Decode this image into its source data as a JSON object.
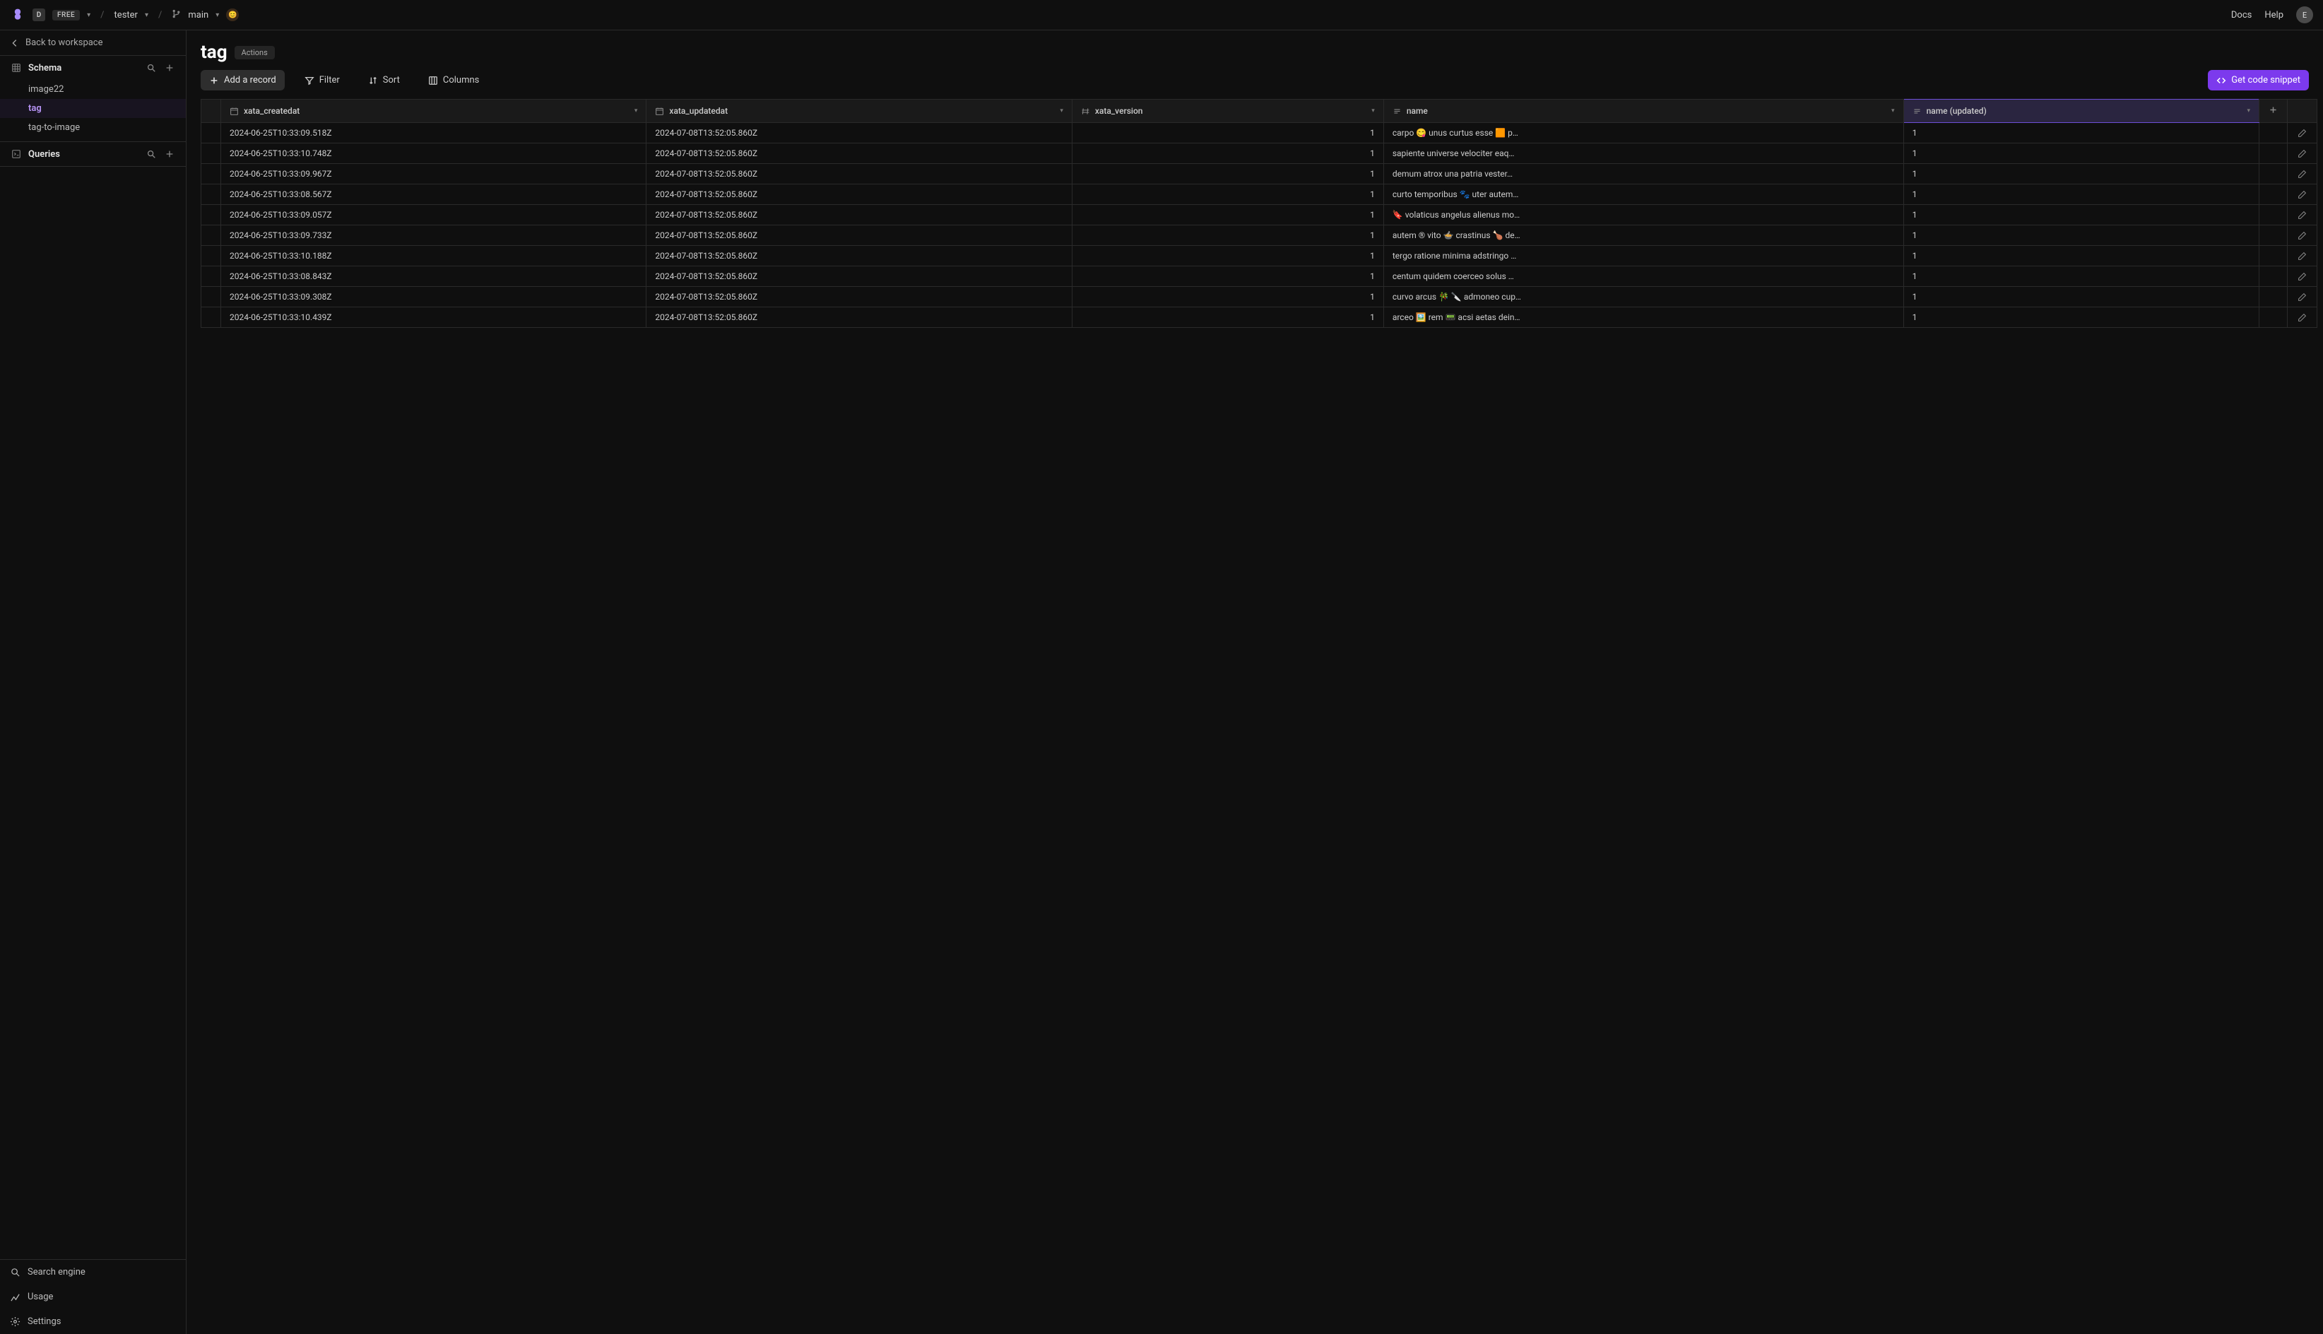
{
  "topbar": {
    "badge_d": "D",
    "badge_free": "FREE",
    "workspace": "tester",
    "branch": "main",
    "docs": "Docs",
    "help": "Help",
    "avatar_initial": "E"
  },
  "sidebar": {
    "back_label": "Back to workspace",
    "schema_label": "Schema",
    "queries_label": "Queries",
    "tables": [
      {
        "label": "image22",
        "active": false
      },
      {
        "label": "tag",
        "active": true
      },
      {
        "label": "tag-to-image",
        "active": false
      }
    ],
    "footer": {
      "search": "Search engine",
      "usage": "Usage",
      "settings": "Settings"
    }
  },
  "header": {
    "title": "tag",
    "actions_label": "Actions"
  },
  "toolbar": {
    "add_record": "Add a record",
    "filter": "Filter",
    "sort": "Sort",
    "columns": "Columns",
    "get_snippet": "Get code snippet"
  },
  "columns": [
    {
      "key": "xata_createdat",
      "label": "xata_createdat",
      "icon": "date"
    },
    {
      "key": "xata_updatedat",
      "label": "xata_updatedat",
      "icon": "date"
    },
    {
      "key": "xata_version",
      "label": "xata_version",
      "icon": "number"
    },
    {
      "key": "name",
      "label": "name",
      "icon": "text"
    },
    {
      "key": "name_updated",
      "label": "name (updated)",
      "icon": "text",
      "highlighted": true
    }
  ],
  "rows": [
    {
      "created": "2024-06-25T10:33:09.518Z",
      "updated": "2024-07-08T13:52:05.860Z",
      "version": "1",
      "name": "carpo 😋 unus curtus esse 🟧 p…",
      "name_updated": "1"
    },
    {
      "created": "2024-06-25T10:33:10.748Z",
      "updated": "2024-07-08T13:52:05.860Z",
      "version": "1",
      "name": "sapiente universe velociter eaq…",
      "name_updated": "1"
    },
    {
      "created": "2024-06-25T10:33:09.967Z",
      "updated": "2024-07-08T13:52:05.860Z",
      "version": "1",
      "name": "demum atrox una patria vester…",
      "name_updated": "1"
    },
    {
      "created": "2024-06-25T10:33:08.567Z",
      "updated": "2024-07-08T13:52:05.860Z",
      "version": "1",
      "name": "curto temporibus 🐾 uter autem…",
      "name_updated": "1"
    },
    {
      "created": "2024-06-25T10:33:09.057Z",
      "updated": "2024-07-08T13:52:05.860Z",
      "version": "1",
      "name": "🔖 volaticus angelus alienus mo…",
      "name_updated": "1"
    },
    {
      "created": "2024-06-25T10:33:09.733Z",
      "updated": "2024-07-08T13:52:05.860Z",
      "version": "1",
      "name": "autem ® vito 🍲 crastinus 🍗 de…",
      "name_updated": "1"
    },
    {
      "created": "2024-06-25T10:33:10.188Z",
      "updated": "2024-07-08T13:52:05.860Z",
      "version": "1",
      "name": "tergo ratione minima adstringo …",
      "name_updated": "1"
    },
    {
      "created": "2024-06-25T10:33:08.843Z",
      "updated": "2024-07-08T13:52:05.860Z",
      "version": "1",
      "name": "centum quidem coerceo solus …",
      "name_updated": "1"
    },
    {
      "created": "2024-06-25T10:33:09.308Z",
      "updated": "2024-07-08T13:52:05.860Z",
      "version": "1",
      "name": "curvo arcus 🎋 🔪 admoneo cup…",
      "name_updated": "1"
    },
    {
      "created": "2024-06-25T10:33:10.439Z",
      "updated": "2024-07-08T13:52:05.860Z",
      "version": "1",
      "name": "arceo 🖼️ rem 📟 acsi aetas dein…",
      "name_updated": "1"
    }
  ]
}
